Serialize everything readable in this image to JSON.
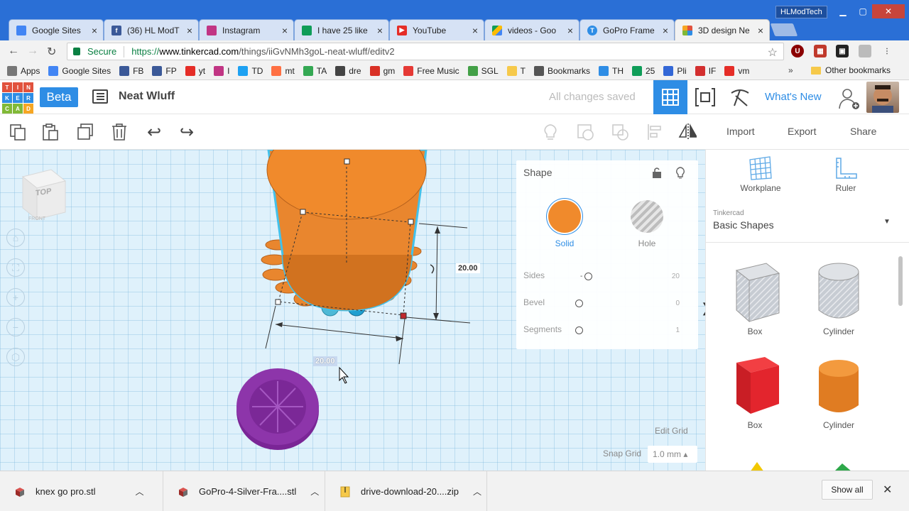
{
  "browser": {
    "tabs": [
      {
        "title": "Google Sites",
        "favicon": "google-sites-icon",
        "color": "#4285f4"
      },
      {
        "title": "(36) HL ModT",
        "favicon": "facebook-icon",
        "color": "#3b5998"
      },
      {
        "title": "Instagram",
        "favicon": "instagram-icon",
        "color": "#c13584"
      },
      {
        "title": "I have 25 like",
        "favicon": "sheets-icon",
        "color": "#0f9d58"
      },
      {
        "title": "YouTube",
        "favicon": "youtube-icon",
        "color": "#e52d27"
      },
      {
        "title": "videos - Goo",
        "favicon": "drive-icon",
        "color": "#fbbc05"
      },
      {
        "title": "GoPro Frame",
        "favicon": "tinkercad-t-icon",
        "color": "#2e8de5"
      },
      {
        "title": "3D design Ne",
        "favicon": "tinkercad-icon",
        "color": "#e1523d"
      }
    ],
    "profile_name": "HLModTech",
    "secure_label": "Secure",
    "url_scheme": "https://",
    "url_host": "www.tinkercad.com",
    "url_path": "/things/iiGvNMh3goL-neat-wluff/editv2"
  },
  "bookmarks": {
    "items": [
      {
        "label": "Apps",
        "icon": "apps-grid-icon",
        "color": "#777777"
      },
      {
        "label": "Google Sites",
        "icon": "google-sites-icon",
        "color": "#4285f4"
      },
      {
        "label": "FB",
        "icon": "facebook-icon",
        "color": "#3b5998"
      },
      {
        "label": "FP",
        "icon": "fp-icon",
        "color": "#3b5998"
      },
      {
        "label": "yt",
        "icon": "youtube-icon",
        "color": "#e52d27"
      },
      {
        "label": "I",
        "icon": "instagram-icon",
        "color": "#c13584"
      },
      {
        "label": "TD",
        "icon": "twitter-icon",
        "color": "#1da1f2"
      },
      {
        "label": "mt",
        "icon": "mt-icon",
        "color": "#ff7043"
      },
      {
        "label": "TA",
        "icon": "ta-icon",
        "color": "#34a853"
      },
      {
        "label": "dre",
        "icon": "dre-icon",
        "color": "#444444"
      },
      {
        "label": "gm",
        "icon": "gmail-icon",
        "color": "#d93025"
      },
      {
        "label": "Free Music",
        "icon": "music-icon",
        "color": "#e53935"
      },
      {
        "label": "SGL",
        "icon": "sgl-icon",
        "color": "#43a047"
      },
      {
        "label": "T",
        "icon": "folder-icon",
        "color": "#f6c94a"
      },
      {
        "label": "Bookmarks",
        "icon": "star-icon",
        "color": "#555555"
      },
      {
        "label": "TH",
        "icon": "th-icon",
        "color": "#2e8de5"
      },
      {
        "label": "25",
        "icon": "sheets-icon",
        "color": "#0f9d58"
      },
      {
        "label": "Pli",
        "icon": "pli-icon",
        "color": "#3367d6"
      },
      {
        "label": "IF",
        "icon": "flag-icon",
        "color": "#d32f2f"
      },
      {
        "label": "vm",
        "icon": "youtube-icon",
        "color": "#e52d27"
      }
    ],
    "more": "»",
    "other_label": "Other bookmarks"
  },
  "header": {
    "logo_letters": [
      "TIN",
      "KER",
      "CAD"
    ],
    "beta_label": "Beta",
    "design_name": "Neat Wluff",
    "save_status": "All changes saved",
    "whats_new": "What's New"
  },
  "toolbar": {
    "import_label": "Import",
    "export_label": "Export",
    "share_label": "Share"
  },
  "workplane": {
    "navcube_top": "TOP",
    "navcube_front": "FRONT",
    "dim_height": "20.00",
    "dim_width": "20.00",
    "edit_grid": "Edit Grid",
    "snap_grid_label": "Snap Grid",
    "snap_grid_value": "1.0 mm ▴"
  },
  "shape_panel": {
    "title": "Shape",
    "solid_label": "Solid",
    "hole_label": "Hole",
    "solid_color": "#f08a2c",
    "rows": [
      {
        "label": "Sides",
        "value": "20"
      },
      {
        "label": "Bevel",
        "value": "0"
      },
      {
        "label": "Segments",
        "value": "1"
      }
    ]
  },
  "library": {
    "workplane_label": "Workplane",
    "ruler_label": "Ruler",
    "source": "Tinkercad",
    "name": "Basic Shapes",
    "shapes": [
      {
        "label": "Box",
        "color": "#9aa4b0"
      },
      {
        "label": "Cylinder",
        "color": "#9aa4b0"
      },
      {
        "label": "Box",
        "color": "#d8232a"
      },
      {
        "label": "Cylinder",
        "color": "#e9862e"
      }
    ]
  },
  "downloads": {
    "items": [
      {
        "name": "knex go pro.stl"
      },
      {
        "name": "GoPro-4-Silver-Fra....stl"
      },
      {
        "name": "drive-download-20....zip"
      }
    ],
    "show_all": "Show all"
  }
}
